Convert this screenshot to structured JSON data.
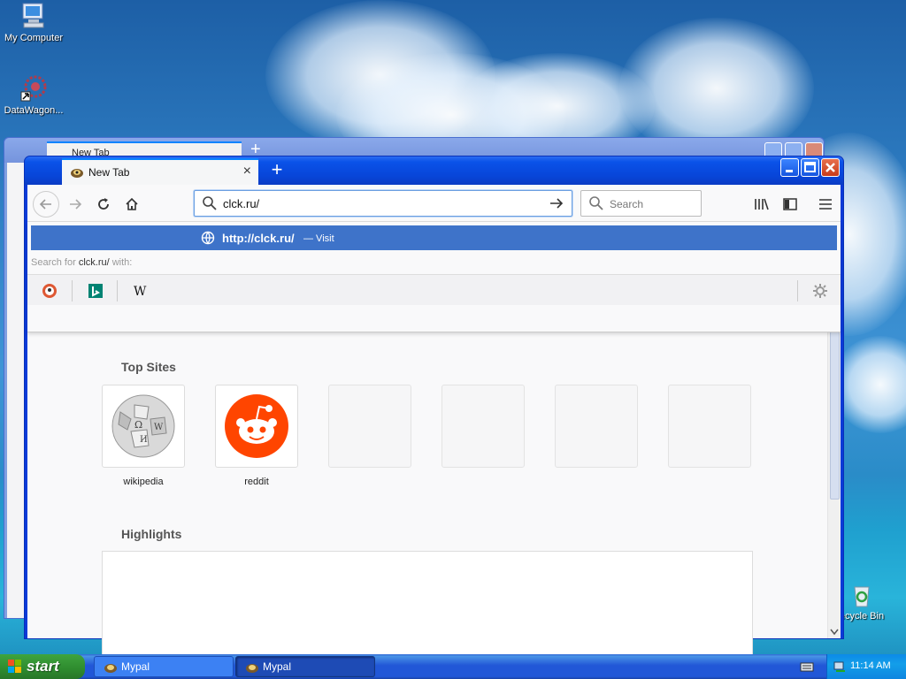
{
  "desktop": {
    "icons": [
      {
        "label": "My Computer"
      },
      {
        "label": "DataWagon..."
      },
      {
        "label": "ecycle Bin"
      }
    ]
  },
  "back_window": {
    "tab_title": "New Tab"
  },
  "browser": {
    "tab_title": "New Tab",
    "url_value": "clck.ru/",
    "search_placeholder": "Search",
    "suggestion_url": "http://clck.ru/",
    "suggestion_action": "— Visit",
    "search_with_prefix": "Search for",
    "search_with_term": "clck.ru/",
    "search_with_suffix": "with:",
    "engines": [
      "duckduckgo-icon",
      "bing-icon",
      "wikipedia-icon"
    ],
    "top_sites_heading": "Top Sites",
    "top_sites": [
      {
        "label": "wikipedia"
      },
      {
        "label": "reddit"
      },
      {
        "label": ""
      },
      {
        "label": ""
      },
      {
        "label": ""
      },
      {
        "label": ""
      }
    ],
    "highlights_heading": "Highlights"
  },
  "taskbar": {
    "start_label": "start",
    "items": [
      {
        "label": "Mypal"
      },
      {
        "label": "Mypal"
      }
    ],
    "clock": "11:14 AM"
  },
  "colors": {
    "accent": "#0a84ff",
    "suggestion_bg": "#3e73c9",
    "reddit": "#ff4500"
  }
}
